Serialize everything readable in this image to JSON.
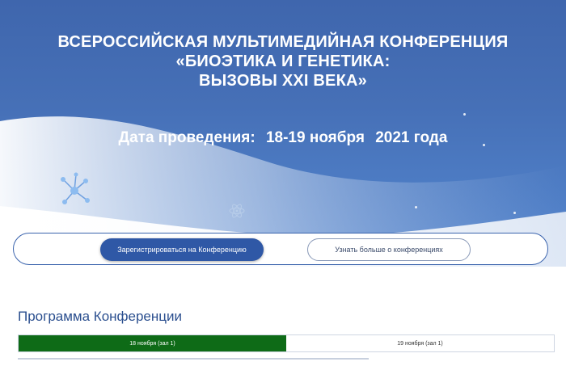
{
  "header": {
    "title_line1": "ВСЕРОССИЙСКАЯ МУЛЬТИМЕДИЙНАЯ КОНФЕРЕНЦИЯ",
    "title_line2": "«БИОЭТИКА И ГЕНЕТИКА:",
    "title_line3": "ВЫЗОВЫ XXI ВЕКА»",
    "date_label": "Дата проведения:",
    "date_days": "18-19 ноября",
    "date_year": "2021 года"
  },
  "actions": {
    "register_label": "Зарегистрироваться на Конференцию",
    "learn_more_label": "Узнать больше о конференциях"
  },
  "program": {
    "title": "Программа Конференции",
    "tabs": [
      {
        "label": "18 ноября (зал 1)",
        "active": true
      },
      {
        "label": "19 ноября (зал 1)",
        "active": false
      }
    ]
  },
  "colors": {
    "hero_blue": "#4670b7",
    "primary_button": "#2f58a6",
    "active_tab": "#0e6b17",
    "section_title": "#2b4f8f"
  },
  "icons": [
    "molecule-icon",
    "atom-icon"
  ]
}
